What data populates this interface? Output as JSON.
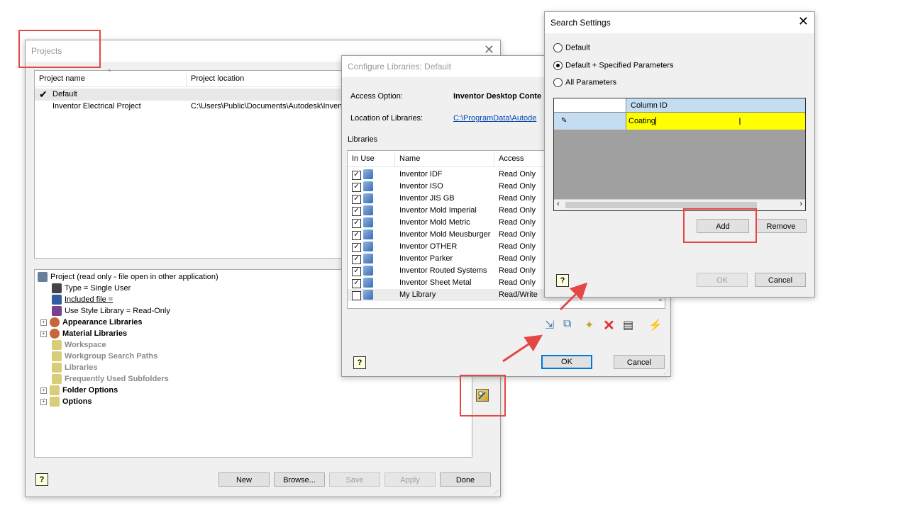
{
  "projects": {
    "title": "Projects",
    "columns": [
      "Project name",
      "Project location"
    ],
    "rows": [
      {
        "name": "Default",
        "location": "",
        "active": true
      },
      {
        "name": "Inventor Electrical Project",
        "location": "C:\\Users\\Public\\Documents\\Autodesk\\Invent",
        "active": false
      }
    ],
    "tree": [
      {
        "label": "Project (read only - file open in other application)",
        "bold": false,
        "gray": false,
        "indent": 0,
        "expander": false,
        "icon": "ipj-icon"
      },
      {
        "label": "Type = Single User",
        "bold": false,
        "gray": false,
        "indent": 1,
        "expander": false,
        "icon": "user-icon"
      },
      {
        "label": "Included file =",
        "bold": false,
        "gray": false,
        "indent": 1,
        "expander": false,
        "icon": "include-icon",
        "underline": true
      },
      {
        "label": "Use Style Library = Read-Only",
        "bold": false,
        "gray": false,
        "indent": 1,
        "expander": false,
        "icon": "style-icon"
      },
      {
        "label": "Appearance Libraries",
        "bold": true,
        "gray": false,
        "indent": 0,
        "expander": true,
        "icon": "sphere-icon"
      },
      {
        "label": "Material Libraries",
        "bold": true,
        "gray": false,
        "indent": 0,
        "expander": true,
        "icon": "sphere-icon"
      },
      {
        "label": "Workspace",
        "bold": true,
        "gray": true,
        "indent": 1,
        "expander": false,
        "icon": "folder-icon"
      },
      {
        "label": "Workgroup Search Paths",
        "bold": true,
        "gray": true,
        "indent": 1,
        "expander": false,
        "icon": "folder-icon"
      },
      {
        "label": "Libraries",
        "bold": true,
        "gray": true,
        "indent": 1,
        "expander": false,
        "icon": "folder-icon"
      },
      {
        "label": "Frequently Used Subfolders",
        "bold": true,
        "gray": true,
        "indent": 1,
        "expander": false,
        "icon": "folder-icon"
      },
      {
        "label": "Folder Options",
        "bold": true,
        "gray": false,
        "indent": 0,
        "expander": true,
        "icon": "folder-icon"
      },
      {
        "label": "Options",
        "bold": true,
        "gray": false,
        "indent": 0,
        "expander": true,
        "icon": "folder-icon"
      }
    ],
    "buttons": {
      "new": "New",
      "browse": "Browse...",
      "save": "Save",
      "apply": "Apply",
      "done": "Done"
    },
    "help": "?"
  },
  "configure": {
    "title": "Configure Libraries: Default",
    "access_option_label": "Access Option:",
    "access_option_value": "Inventor Desktop Conte",
    "location_label": "Location of Libraries:",
    "location_value": "C:\\ProgramData\\Autode",
    "libraries_label": "Libraries",
    "columns": [
      "In Use",
      "Name",
      "Access"
    ],
    "rows": [
      {
        "checked": true,
        "name": "Inventor IDF",
        "access": "Read Only"
      },
      {
        "checked": true,
        "name": "Inventor ISO",
        "access": "Read Only"
      },
      {
        "checked": true,
        "name": "Inventor JIS GB",
        "access": "Read Only"
      },
      {
        "checked": true,
        "name": "Inventor Mold Imperial",
        "access": "Read Only"
      },
      {
        "checked": true,
        "name": "Inventor Mold Metric",
        "access": "Read Only"
      },
      {
        "checked": true,
        "name": "Inventor Mold Meusburger",
        "access": "Read Only"
      },
      {
        "checked": true,
        "name": "Inventor OTHER",
        "access": "Read Only"
      },
      {
        "checked": true,
        "name": "Inventor Parker",
        "access": "Read Only"
      },
      {
        "checked": true,
        "name": "Inventor Routed Systems",
        "access": "Read Only"
      },
      {
        "checked": true,
        "name": "Inventor Sheet Metal",
        "access": "Read Only"
      },
      {
        "checked": false,
        "name": "My Library",
        "access": "Read/Write"
      }
    ],
    "ok": "OK",
    "cancel": "Cancel",
    "help": "?"
  },
  "search": {
    "title": "Search Settings",
    "options": [
      {
        "label": "Default",
        "selected": false
      },
      {
        "label": "Default + Specified Parameters",
        "selected": true
      },
      {
        "label": "All Parameters",
        "selected": false
      }
    ],
    "grid_header": "Column ID",
    "grid_value": "Coating",
    "add": "Add",
    "remove": "Remove",
    "ok": "OK",
    "cancel": "Cancel",
    "help": "?"
  },
  "colors": {
    "highlight": "#ffff00",
    "header_blue": "#c5ddf0",
    "annotation_red": "#e54646",
    "link": "#0645ad"
  }
}
